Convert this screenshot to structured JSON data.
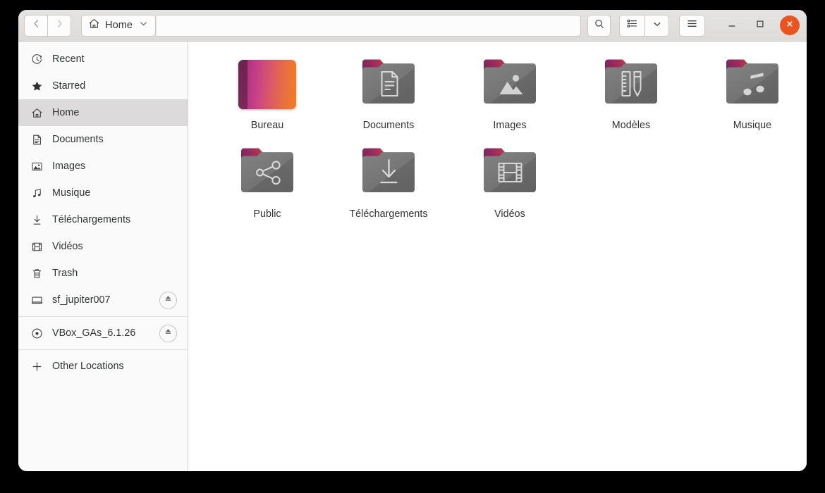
{
  "window": {
    "title": "Home",
    "accent_color": "#e95420",
    "headerbar_color": "#e2dfdd",
    "content_color": "#ffffff",
    "sidebar_color": "#fafafa"
  },
  "headerbar": {
    "back_icon": "chevron-left-icon",
    "forward_icon": "chevron-right-icon",
    "path_icon": "home-icon",
    "path_label": "Home",
    "path_dropdown_icon": "chevron-down-icon",
    "location_entry_value": "",
    "location_entry_placeholder": "",
    "search_icon": "search-icon",
    "view_list_icon": "list-view-icon",
    "view_dropdown_icon": "chevron-down-icon",
    "menu_icon": "hamburger-menu-icon",
    "minimize_icon": "minimize-icon",
    "maximize_icon": "maximize-icon",
    "close_icon": "close-icon"
  },
  "sidebar": {
    "items": [
      {
        "label": "Recent",
        "icon": "clock-icon",
        "selected": false,
        "eject": false
      },
      {
        "label": "Starred",
        "icon": "star-icon",
        "selected": false,
        "eject": false
      },
      {
        "label": "Home",
        "icon": "home-icon",
        "selected": true,
        "eject": false
      },
      {
        "label": "Documents",
        "icon": "document-icon",
        "selected": false,
        "eject": false
      },
      {
        "label": "Images",
        "icon": "image-icon",
        "selected": false,
        "eject": false
      },
      {
        "label": "Musique",
        "icon": "music-icon",
        "selected": false,
        "eject": false
      },
      {
        "label": "Téléchargements",
        "icon": "download-icon",
        "selected": false,
        "eject": false
      },
      {
        "label": "Vidéos",
        "icon": "video-icon",
        "selected": false,
        "eject": false
      },
      {
        "label": "Trash",
        "icon": "trash-icon",
        "selected": false,
        "eject": false
      },
      {
        "label": "sf_jupiter007",
        "icon": "drive-icon",
        "selected": false,
        "eject": true
      },
      {
        "label": "VBox_GAs_6.1.26",
        "icon": "disc-icon",
        "selected": false,
        "eject": true
      },
      {
        "label": "Other Locations",
        "icon": "plus-icon",
        "selected": false,
        "eject": false
      }
    ],
    "separator_after": [
      9,
      10
    ],
    "eject_icon": "eject-icon"
  },
  "content": {
    "files": [
      {
        "label": "Bureau",
        "kind": "picture-thumbnail",
        "emblem": "none"
      },
      {
        "label": "Documents",
        "kind": "folder",
        "emblem": "document-emblem"
      },
      {
        "label": "Images",
        "kind": "folder",
        "emblem": "image-emblem"
      },
      {
        "label": "Modèles",
        "kind": "folder",
        "emblem": "templates-emblem"
      },
      {
        "label": "Musique",
        "kind": "folder",
        "emblem": "music-emblem"
      },
      {
        "label": "Public",
        "kind": "folder",
        "emblem": "share-emblem"
      },
      {
        "label": "Téléchargements",
        "kind": "folder",
        "emblem": "download-emblem"
      },
      {
        "label": "Vidéos",
        "kind": "folder",
        "emblem": "video-emblem"
      }
    ]
  }
}
